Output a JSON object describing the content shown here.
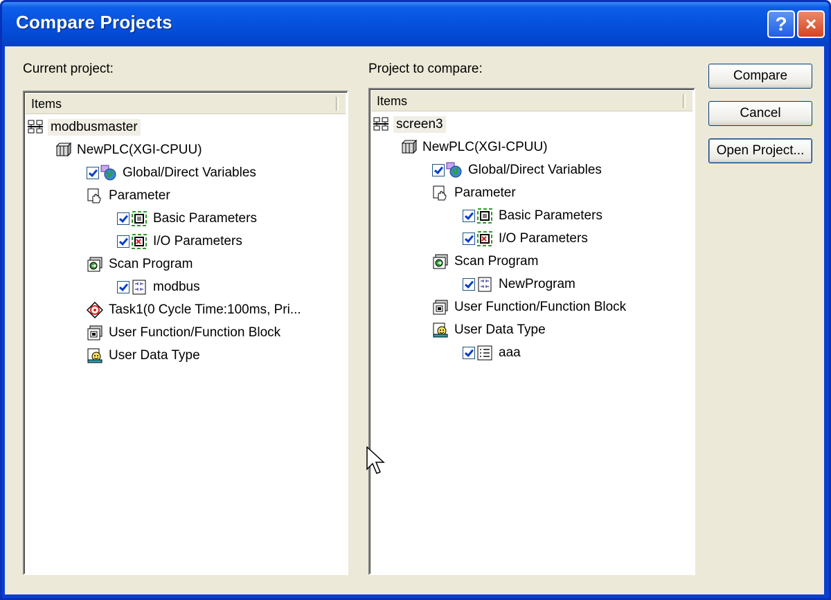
{
  "window": {
    "title": "Compare Projects",
    "help_glyph": "?",
    "close_glyph": "×"
  },
  "left": {
    "label": "Current project:",
    "column": "Items",
    "items": [
      {
        "text": "modbusmaster"
      },
      {
        "text": "NewPLC(XGI-CPUU)"
      },
      {
        "text": "Global/Direct Variables"
      },
      {
        "text": "Parameter"
      },
      {
        "text": "Basic Parameters"
      },
      {
        "text": "I/O Parameters"
      },
      {
        "text": "Scan Program"
      },
      {
        "text": "modbus"
      },
      {
        "text": "Task1(0 Cycle Time:100ms, Pri..."
      },
      {
        "text": "User Function/Function Block"
      },
      {
        "text": "User Data Type"
      }
    ]
  },
  "right": {
    "label": "Project to compare:",
    "column": "Items",
    "items": [
      {
        "text": "screen3"
      },
      {
        "text": "NewPLC(XGI-CPUU)"
      },
      {
        "text": "Global/Direct Variables"
      },
      {
        "text": "Parameter"
      },
      {
        "text": "Basic Parameters"
      },
      {
        "text": "I/O Parameters"
      },
      {
        "text": "Scan Program"
      },
      {
        "text": "NewProgram"
      },
      {
        "text": "User Function/Function Block"
      },
      {
        "text": "User Data Type"
      },
      {
        "text": "aaa"
      }
    ]
  },
  "buttons": {
    "compare": "Compare",
    "cancel": "Cancel",
    "open": "Open Project..."
  }
}
